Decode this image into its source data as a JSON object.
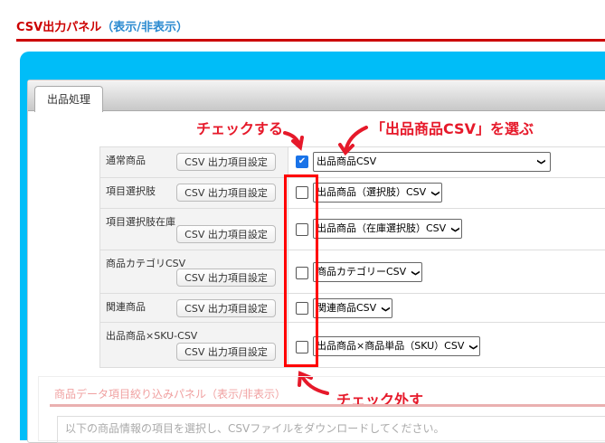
{
  "header": {
    "title": "CSV出力パネル",
    "toggle": "（表示/非表示）"
  },
  "tab": "出品処理",
  "annotations": {
    "check": "チェックする",
    "select": "「出品商品CSV」を選ぶ",
    "uncheck": "チェック外す"
  },
  "button_label": "CSV 出力項目設定",
  "rows": [
    {
      "label": "通常商品",
      "checked": true,
      "select": "出品商品CSV"
    },
    {
      "label": "項目選択肢",
      "checked": false,
      "select": "出品商品（選択肢）CSV"
    },
    {
      "label": "項目選択肢在庫",
      "checked": false,
      "select": "出品商品（在庫選択肢）CSV"
    },
    {
      "label": "商品カテゴリCSV",
      "checked": false,
      "select": "商品カテゴリーCSV"
    },
    {
      "label": "関連商品",
      "checked": false,
      "select": "関連商品CSV"
    },
    {
      "label": "出品商品×SKU-CSV",
      "checked": false,
      "select": "出品商品×商品単品（SKU）CSV"
    }
  ],
  "filter_panel": {
    "title": "商品データ項目絞り込みパネル（表示/非表示）",
    "description": "以下の商品情報の項目を選択し、CSVファイルをダウンロードしてください。"
  },
  "colors": {
    "accent": "#cc0000",
    "panel": "#00bdf8",
    "annotation": "#e6192a"
  }
}
